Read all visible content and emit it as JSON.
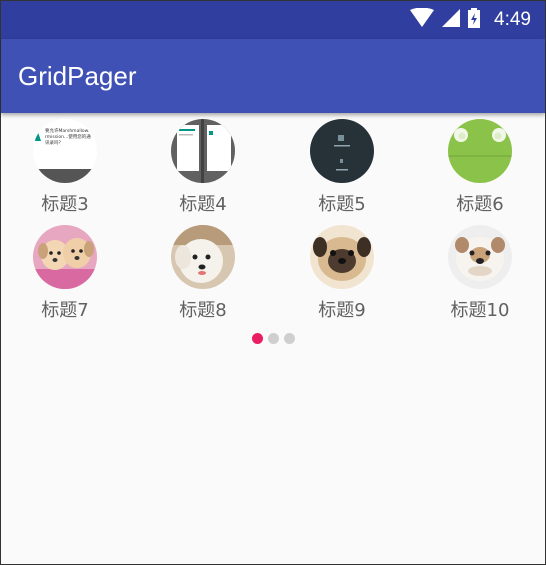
{
  "status_bar": {
    "time": "4:49"
  },
  "app_bar": {
    "title": "GridPager"
  },
  "grid": {
    "items": [
      {
        "label": "标题3",
        "icon": "screenshot-dialog-thumbnail",
        "dialog_text": [
          "要允许Marshmallow.",
          "rmission...使用您的通",
          "讯录吗？"
        ]
      },
      {
        "label": "标题4",
        "icon": "screenshot-split-thumbnail"
      },
      {
        "label": "标题5",
        "icon": "screenshot-dark-thumbnail"
      },
      {
        "label": "标题6",
        "icon": "android-robot-thumbnail"
      },
      {
        "label": "标题7",
        "icon": "puppies-photo"
      },
      {
        "label": "标题8",
        "icon": "white-dog-photo"
      },
      {
        "label": "标题9",
        "icon": "pug-photo"
      },
      {
        "label": "标题10",
        "icon": "bulldog-photo"
      }
    ]
  },
  "pager": {
    "pages": 3,
    "current": 1
  },
  "colors": {
    "primary": "#3f51b5",
    "primary_dark": "#303f9f",
    "accent": "#e91e63"
  }
}
